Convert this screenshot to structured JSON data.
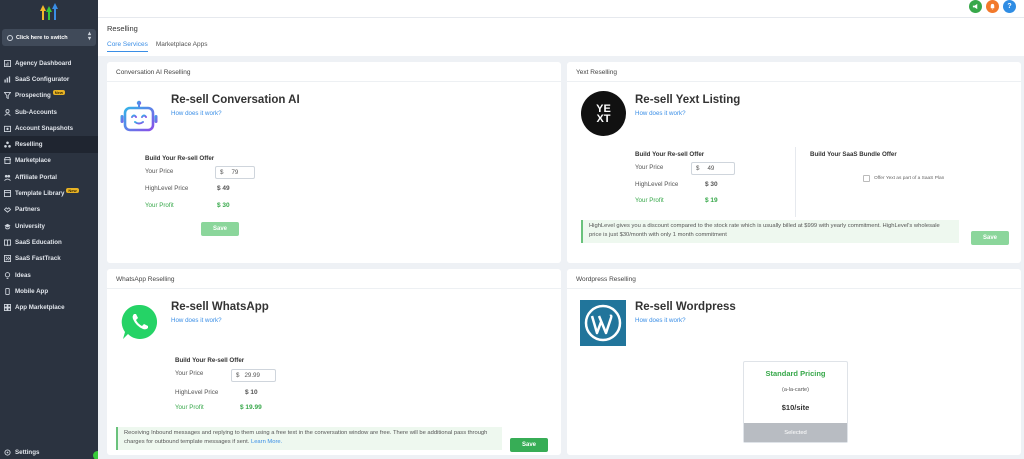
{
  "sidebar": {
    "switcher_label": "Click here to switch",
    "items": [
      {
        "label": "Agency Dashboard",
        "icon": "dashboard-icon"
      },
      {
        "label": "SaaS Configurator",
        "icon": "chart-bars-icon"
      },
      {
        "label": "Prospecting",
        "icon": "funnel-icon",
        "badge": "New"
      },
      {
        "label": "Sub-Accounts",
        "icon": "users-icon"
      },
      {
        "label": "Account Snapshots",
        "icon": "snapshot-icon"
      },
      {
        "label": "Reselling",
        "icon": "resell-icon",
        "active": true
      },
      {
        "label": "Marketplace",
        "icon": "store-icon"
      },
      {
        "label": "Affiliate Portal",
        "icon": "affiliate-icon"
      },
      {
        "label": "Template Library",
        "icon": "library-icon",
        "badge": "New"
      },
      {
        "label": "Partners",
        "icon": "handshake-icon"
      },
      {
        "label": "University",
        "icon": "graduation-icon"
      },
      {
        "label": "SaaS Education",
        "icon": "education-icon"
      },
      {
        "label": "SaaS FastTrack",
        "icon": "fasttrack-icon"
      },
      {
        "label": "Ideas",
        "icon": "lightbulb-icon"
      },
      {
        "label": "Mobile App",
        "icon": "mobile-icon"
      },
      {
        "label": "App Marketplace",
        "icon": "grid-icon"
      }
    ],
    "settings_label": "Settings"
  },
  "header": {
    "title": "Reselling",
    "tabs": [
      "Core Services",
      "Marketplace Apps"
    ]
  },
  "top_icons": {
    "a": "!",
    "b": "?"
  },
  "cards": {
    "conversation_ai": {
      "title": "Conversation AI Reselling",
      "product": "Re-sell Conversation AI",
      "how": "How does it work?",
      "offer_heading": "Build Your Re-sell Offer",
      "your_price_label": "Your Price",
      "currency": "$",
      "your_price_value": "79",
      "hl_price_label": "HighLevel Price",
      "hl_price_value": "$ 49",
      "profit_label": "Your Profit",
      "profit_value": "$ 30",
      "save_label": "Save"
    },
    "yext": {
      "title": "Yext Reselling",
      "product": "Re-sell Yext Listing",
      "how": "How does it work?",
      "logo_text_top": "YE",
      "logo_text_bottom": "XT",
      "offer_heading": "Build Your Re-sell Offer",
      "your_price_label": "Your Price",
      "currency": "$",
      "your_price_value": "49",
      "hl_price_label": "HighLevel Price",
      "hl_price_value": "$ 30",
      "profit_label": "Your Profit",
      "profit_value": "$ 19",
      "bundle_heading": "Build Your SaaS Bundle Offer",
      "bundle_checkbox": "Offer Yext as part of a SaaS Plan",
      "note": "HighLevel gives you a discount compared to the stock rate which is usually billed at $999 with yearly commitment. HighLevel's wholesale price is just $30/month with only 1 month commitment",
      "save_label": "Save"
    },
    "whatsapp": {
      "title": "WhatsApp Reselling",
      "product": "Re-sell WhatsApp",
      "how": "How does it work?",
      "offer_heading": "Build Your Re-sell Offer",
      "your_price_label": "Your Price",
      "currency": "$",
      "your_price_value": "29.99",
      "hl_price_label": "HighLevel Price",
      "hl_price_value": "$ 10",
      "profit_label": "Your Profit",
      "profit_value": "$ 19.99",
      "note": "Receiving Inbound messages and replying to them using a free text in the conversation window are free. There will be additional pass through charges for outbound template messages if sent.",
      "learn_more": "Learn More.",
      "save_label": "Save"
    },
    "wordpress": {
      "title": "Wordpress Reselling",
      "product": "Re-sell Wordpress",
      "how": "How does it work?",
      "pricing_title": "Standard Pricing",
      "pricing_sub": "(a-la-carte)",
      "pricing_price": "$10/site",
      "pricing_selected": "Selected"
    }
  },
  "colors": {
    "sidebar_bg": "#2b3340",
    "accent_blue": "#3a8ee6",
    "green": "#37a84a",
    "whatsapp": "#25d366",
    "wordpress": "#21759b"
  }
}
